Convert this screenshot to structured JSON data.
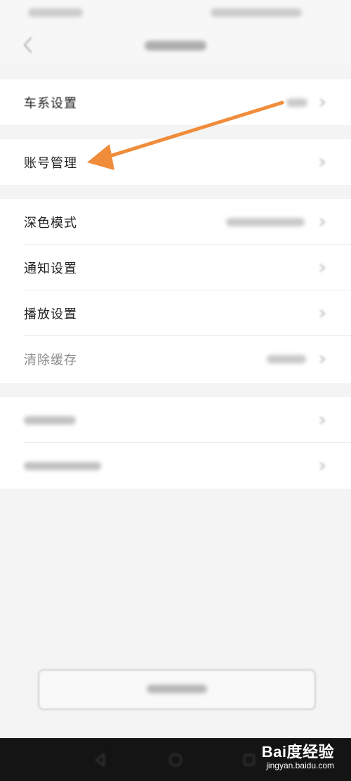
{
  "settings": {
    "car_series": {
      "label": "车系设置"
    },
    "account": {
      "label": "账号管理"
    },
    "dark_mode": {
      "label": "深色模式"
    },
    "notifications": {
      "label": "通知设置"
    },
    "playback": {
      "label": "播放设置"
    },
    "clear_cache": {
      "label": "清除缓存"
    }
  },
  "watermark": {
    "brand": "Bai度经验",
    "url": "jingyan.baidu.com"
  },
  "colors": {
    "annotation_arrow": "#f08c3a",
    "background": "#f4f4f4",
    "card": "#ffffff",
    "system_bar": "#141414"
  },
  "icons": [
    "chevron-left-icon",
    "chevron-right-icon",
    "annotation-arrow",
    "nav-back-icon",
    "nav-home-icon",
    "nav-recent-icon",
    "baidu-paw-icon"
  ]
}
